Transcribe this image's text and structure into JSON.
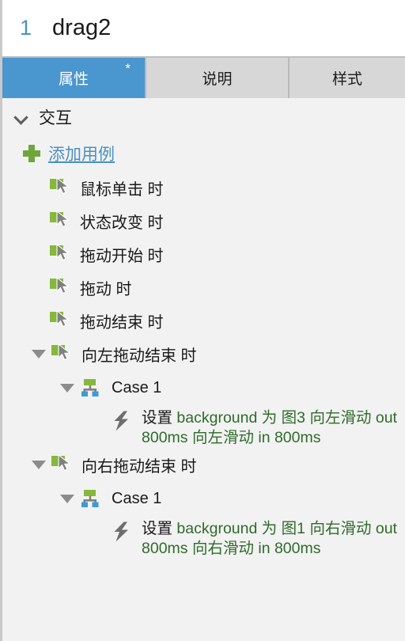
{
  "header": {
    "index": "1",
    "title": "drag2"
  },
  "tabs": [
    {
      "label": "属性",
      "active": true,
      "badge": "*"
    },
    {
      "label": "说明",
      "active": false,
      "badge": ""
    },
    {
      "label": "样式",
      "active": false,
      "badge": ""
    }
  ],
  "section": {
    "label": "交互",
    "expanded": true,
    "chevron_icon": "chevron-down-icon"
  },
  "add_case": {
    "label": "添加用例",
    "plus_icon": "plus-icon"
  },
  "events": [
    {
      "label": "鼠标单击 时",
      "expandable": false,
      "icon": "event-cursor-icon"
    },
    {
      "label": "状态改变 时",
      "expandable": false,
      "icon": "event-cursor-icon"
    },
    {
      "label": "拖动开始 时",
      "expandable": false,
      "icon": "event-cursor-icon"
    },
    {
      "label": "拖动 时",
      "expandable": false,
      "icon": "event-cursor-icon"
    },
    {
      "label": "拖动结束 时",
      "expandable": false,
      "icon": "event-cursor-icon"
    },
    {
      "label": "向左拖动结束 时",
      "expandable": true,
      "expanded": true,
      "icon": "event-cursor-icon",
      "case": {
        "label": "Case 1",
        "icon": "case-tree-icon",
        "expanded": true,
        "action": {
          "icon": "lightning-bolt-icon",
          "verb": "设置",
          "detail": " background 为 图3 向左滑动 out 800ms 向左滑动 in 800ms"
        }
      }
    },
    {
      "label": "向右拖动结束 时",
      "expandable": true,
      "expanded": true,
      "icon": "event-cursor-icon",
      "case": {
        "label": "Case 1",
        "icon": "case-tree-icon",
        "expanded": true,
        "action": {
          "icon": "lightning-bolt-icon",
          "verb": "设置",
          "detail": " background 为 图1 向右滑动 out 800ms 向右滑动 in 800ms"
        }
      }
    }
  ],
  "colors": {
    "accent_blue": "#4a96cf",
    "link_blue": "#4a90c4",
    "green_icon": "#85b83b",
    "action_green": "#2f6b2b",
    "tab_inactive": "#d7d7d7",
    "panel_bg": "#f2f2f2"
  }
}
